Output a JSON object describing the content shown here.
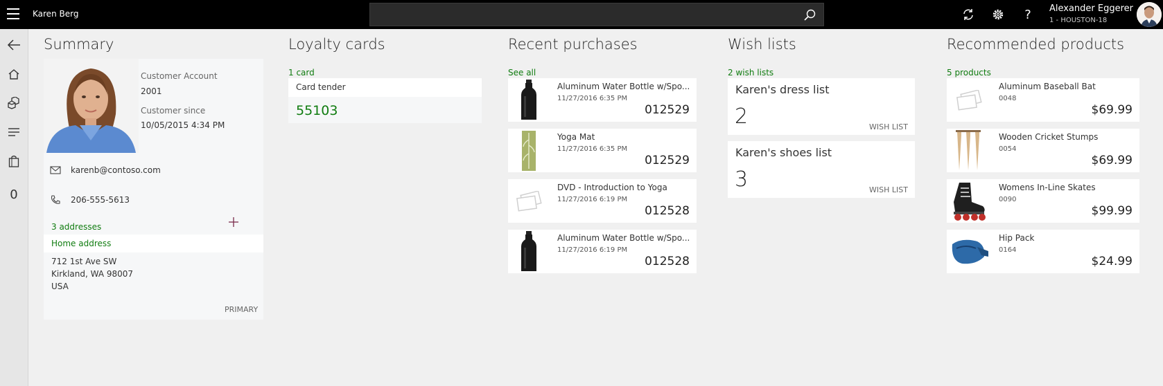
{
  "topbar": {
    "customer_name": "Karen Berg",
    "search_value": "",
    "user_name": "Alexander Eggerer",
    "user_store": "1 - HOUSTON-18"
  },
  "leftnav": {
    "cart_count": "0"
  },
  "summary": {
    "title": "Summary",
    "account_label": "Customer Account",
    "account_value": "2001",
    "since_label": "Customer since",
    "since_value": "10/05/2015 4:34 PM",
    "email": "karenb@contoso.com",
    "phone": "206-555-5613",
    "addresses_link": "3 addresses",
    "address_type": "Home address",
    "address_lines": [
      "712 1st Ave SW",
      "Kirkland, WA 98007",
      "USA"
    ],
    "primary_label": "PRIMARY"
  },
  "loyalty": {
    "title": "Loyalty cards",
    "count_link": "1 card",
    "card_type": "Card tender",
    "card_number": "55103"
  },
  "recent": {
    "title": "Recent purchases",
    "see_all": "See all",
    "items": [
      {
        "name": "Aluminum Water Bottle w/Spo...",
        "date": "11/27/2016 6:35 PM",
        "number": "012529",
        "icon": "bottle"
      },
      {
        "name": "Yoga Mat",
        "date": "11/27/2016 6:35 PM",
        "number": "012529",
        "icon": "yoga-mat"
      },
      {
        "name": "DVD - Introduction to Yoga",
        "date": "11/27/2016 6:19 PM",
        "number": "012528",
        "icon": "placeholder"
      },
      {
        "name": "Aluminum Water Bottle w/Spo...",
        "date": "11/27/2016 6:19 PM",
        "number": "012528",
        "icon": "bottle"
      }
    ]
  },
  "wishlists": {
    "title": "Wish lists",
    "count_link": "2 wish lists",
    "items": [
      {
        "name": "Karen's dress list",
        "count": "2",
        "tag": "WISH LIST"
      },
      {
        "name": "Karen's shoes list",
        "count": "3",
        "tag": "WISH LIST"
      }
    ]
  },
  "recommended": {
    "title": "Recommended products",
    "count_link": "5 products",
    "items": [
      {
        "name": "Aluminum Baseball Bat",
        "code": "0048",
        "price": "$69.99",
        "icon": "placeholder"
      },
      {
        "name": "Wooden Cricket Stumps",
        "code": "0054",
        "price": "$69.99",
        "icon": "cricket-stumps"
      },
      {
        "name": "Womens In-Line Skates",
        "code": "0090",
        "price": "$99.99",
        "icon": "skate"
      },
      {
        "name": "Hip Pack",
        "code": "0164",
        "price": "$24.99",
        "icon": "hip-pack"
      }
    ]
  },
  "colors": {
    "accent_green": "#107c10",
    "topbar": "#000000"
  }
}
